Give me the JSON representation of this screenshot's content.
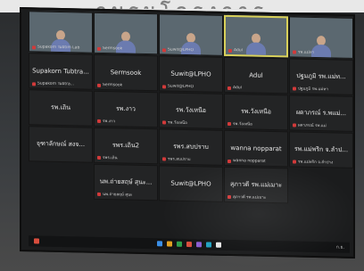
{
  "banner": {
    "text": "อบรมโครงการ"
  },
  "video_tiles": [
    {
      "name": "Supakorn Tubtim Lab",
      "style": "v1"
    },
    {
      "name": "Sermsook",
      "style": "v2"
    },
    {
      "name": "Suwit@LPHO",
      "style": "v3"
    },
    {
      "name": "Adul",
      "style": "v4",
      "active": true
    },
    {
      "name": "รพ.แม่ทา",
      "style": "v5"
    }
  ],
  "tiles": [
    {
      "name": "Supakorn Tubtra...",
      "sub": "Supakorn Tubtra..."
    },
    {
      "name": "Sermsook",
      "sub": "Sermsook"
    },
    {
      "name": "Suwit@LPHO",
      "sub": "Suwit@LPHO"
    },
    {
      "name": "Adul",
      "sub": "Adul"
    },
    {
      "name": "ปฐมภูมิ รพ.แม่ท...",
      "sub": "ปฐมภูมิ รพ.แม่ทา"
    },
    {
      "name": "รพ.เถิน",
      "sub": ""
    },
    {
      "name": "รพ.งาว",
      "sub": "รพ.งาว"
    },
    {
      "name": "รพ.วังเหนือ",
      "sub": "รพ.วังเหนือ"
    },
    {
      "name": "รพ.วังเหนือ",
      "sub": "รพ.วังเหนือ"
    },
    {
      "name": "ผดาภรณ์ ร.พแม่...",
      "sub": "ผดาภรณ์ รพ.แม่"
    },
    {
      "name": "จุฑาลักษณ์ สงจ...",
      "sub": ""
    },
    {
      "name": "รพร.เถิน2",
      "sub": "รพร.เถิน"
    },
    {
      "name": "รพร.สบปราบ",
      "sub": "รพร.สบปราบ"
    },
    {
      "name": "wanna nopparat",
      "sub": "wanna nopparat"
    },
    {
      "name": "รพ.แม่พริก จ.ลำป...",
      "sub": "รพ.แม่พริก จ.ลำปาง"
    },
    {
      "name": "นพ.ถ่ายสฤษ์ สุนะ...",
      "sub": "นพ.ถ่ายสฤษ์ สุนะ"
    },
    {
      "name": "Suwit@LPHO",
      "sub": ""
    },
    {
      "name": "สุภาวดี รพ.แม่เมาะ",
      "sub": "สุภาวดี รพ.แม่เมาะ"
    }
  ],
  "taskbar": {
    "clock": "ก.ย.",
    "icons": [
      "#3a8ee6",
      "#e0a020",
      "#2d9d4b",
      "#d84d3d",
      "#8a5cd0",
      "#20a0c0",
      "#e6e6e6"
    ]
  },
  "monitor": {
    "brand": ""
  }
}
